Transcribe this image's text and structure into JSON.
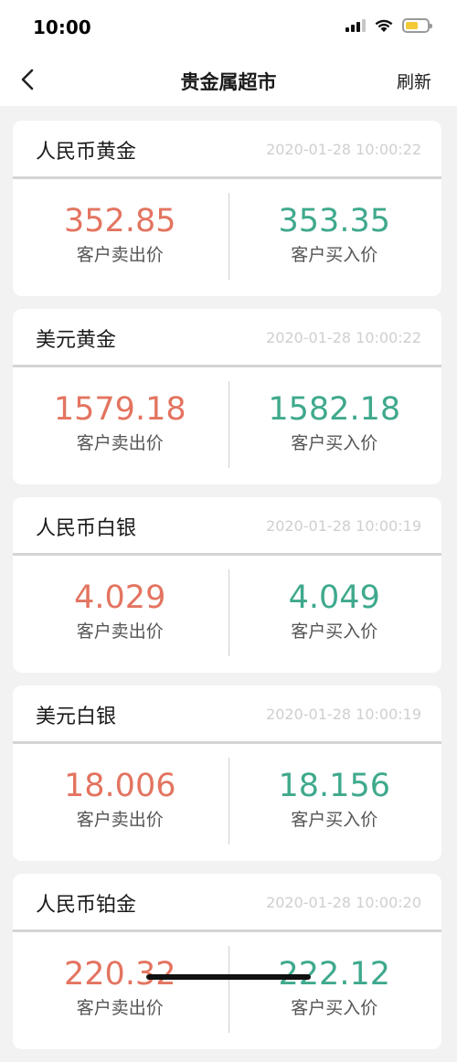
{
  "status": {
    "time": "10:00"
  },
  "nav": {
    "title": "贵金属超市",
    "refresh": "刷新"
  },
  "colors": {
    "sell": "#e37460",
    "buy": "#3fa98d"
  },
  "cards": [
    {
      "name": "人民币黄金",
      "time": "2020-01-28 10:00:22",
      "sell": "352.85",
      "buy": "353.35",
      "sell_label": "客户卖出价",
      "buy_label": "客户买入价"
    },
    {
      "name": "美元黄金",
      "time": "2020-01-28 10:00:22",
      "sell": "1579.18",
      "buy": "1582.18",
      "sell_label": "客户卖出价",
      "buy_label": "客户买入价"
    },
    {
      "name": "人民币白银",
      "time": "2020-01-28 10:00:19",
      "sell": "4.029",
      "buy": "4.049",
      "sell_label": "客户卖出价",
      "buy_label": "客户买入价"
    },
    {
      "name": "美元白银",
      "time": "2020-01-28 10:00:19",
      "sell": "18.006",
      "buy": "18.156",
      "sell_label": "客户卖出价",
      "buy_label": "客户买入价"
    },
    {
      "name": "人民币铂金",
      "time": "2020-01-28 10:00:20",
      "sell": "220.32",
      "buy": "222.12",
      "sell_label": "客户卖出价",
      "buy_label": "客户买入价"
    }
  ]
}
